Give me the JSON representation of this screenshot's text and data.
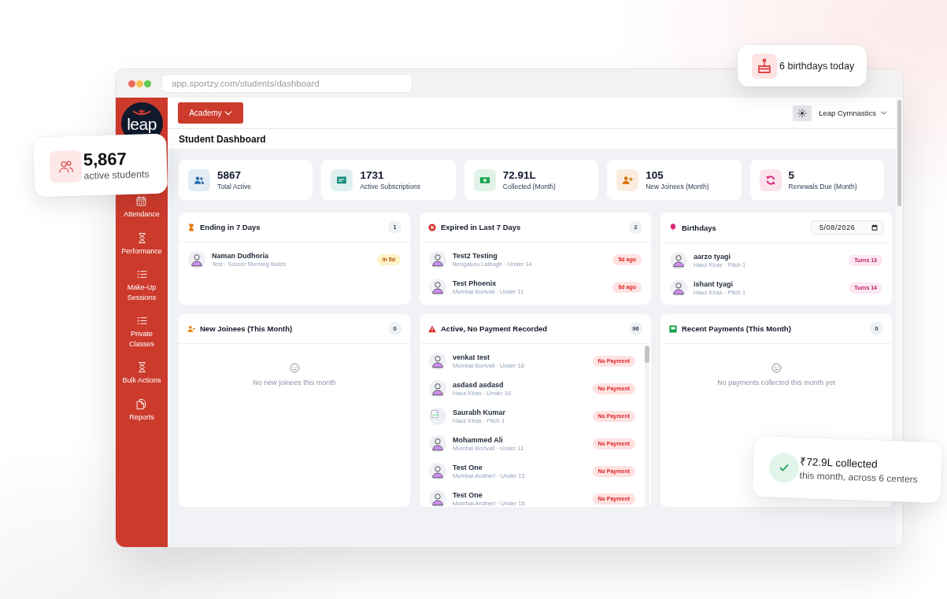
{
  "overlay_cards": [
    {
      "kind": "birthdays",
      "text": "6 birthdays today"
    },
    {
      "kind": "students",
      "value": "5,867",
      "label": "active students"
    },
    {
      "kind": "collected",
      "value": "₹72.9L collected",
      "label": "this month, across 6 centers"
    }
  ],
  "browser": {
    "url": "app.sportzy.com/students/dashboard"
  },
  "sidebar": {
    "logo": "leap",
    "items": [
      {
        "label": "Attendance"
      },
      {
        "label": "Performance"
      },
      {
        "label": "Make-Up Sessions"
      },
      {
        "label": "Private Classes"
      },
      {
        "label": "Bulk Actions"
      },
      {
        "label": "Reports"
      }
    ]
  },
  "header": {
    "academy_button": "Academy",
    "organization": "Leap Cymnastics"
  },
  "page_title": "Student Dashboard",
  "stats": [
    {
      "value": "5867",
      "label": "Total Active",
      "color": "#2b6cb0"
    },
    {
      "value": "1731",
      "label": "Active Subscriptions",
      "color": "#0f8a7c"
    },
    {
      "value": "72.91L",
      "label": "Collected (Month)",
      "color": "#16a34a"
    },
    {
      "value": "105",
      "label": "New Joinees (Month)",
      "color": "#d97706"
    },
    {
      "value": "5",
      "label": "Renewals Due (Month)",
      "color": "#db2777"
    }
  ],
  "panels": [
    {
      "kind": "upcoming",
      "title": "Ending in 7 Days",
      "count": "1",
      "color": "#ea7a0c",
      "scrollable": false,
      "items": [
        {
          "kind": "person",
          "name": "Naman Dudhoria",
          "details": "Test · Soccer Morning Batch",
          "badge": "In 5d"
        }
      ]
    },
    {
      "kind": "overdue",
      "title": "Expired in Last 7 Days",
      "count": "2",
      "color": "#dc2626",
      "scrollable": false,
      "items": [
        {
          "kind": "person",
          "name": "Test2 Testing",
          "details": "Bengaluru Lalbagh · Under 14",
          "badge": "5d ago"
        },
        {
          "kind": "person",
          "name": "Test Phoenix",
          "details": "Mumbai Borivali · Under 11",
          "badge": "6d ago"
        }
      ]
    },
    {
      "kind": "birthday",
      "title": "Birthdays",
      "date_field": {
        "value": "5/08/2026"
      },
      "color": "#db2777",
      "scrollable": false,
      "items": [
        {
          "kind": "person",
          "name": "aarzo tyagi",
          "details": "Hauz Khas · Pitch 1",
          "badge": "Turns 13"
        },
        {
          "kind": "person",
          "name": "ishant tyagi",
          "details": "Hauz Khas · Pitch 1",
          "badge": "Turns 14"
        }
      ]
    },
    {
      "kind": "empty",
      "title": "New Joinees (This Month)",
      "count": "0",
      "color": "#ea7a0c",
      "message": "No new joinees this month"
    },
    {
      "kind": "overdue",
      "title": "Active, No Payment Recorded",
      "count": "96",
      "color": "#dc2626",
      "scrollable": true,
      "items": [
        {
          "kind": "person",
          "name": "venkat test",
          "details": "Mumbai Borivali · Under 18",
          "badge": "No Payment"
        },
        {
          "kind": "person",
          "name": "asdasd asdasd",
          "details": "Hauz Khas · Under 16",
          "badge": "No Payment"
        },
        {
          "kind": "broken_image",
          "name": "Saurabh Kumar",
          "details": "Hauz Khas · Pitch 1",
          "badge": "No Payment"
        },
        {
          "kind": "person",
          "name": "Mohammed Ali",
          "details": "Mumbai Borivali · Under 11",
          "badge": "No Payment"
        },
        {
          "kind": "person",
          "name": "Test One",
          "details": "Mumbai Andheri · Under 15",
          "badge": "No Payment"
        },
        {
          "kind": "person",
          "name": "Test One",
          "details": "Mumbai Andheri · Under 15",
          "badge": "No Payment"
        }
      ]
    },
    {
      "kind": "empty",
      "title": "Recent Payments (This Month)",
      "count": "0",
      "color": "#16a34a",
      "message": "No payments collected this month yet"
    }
  ]
}
